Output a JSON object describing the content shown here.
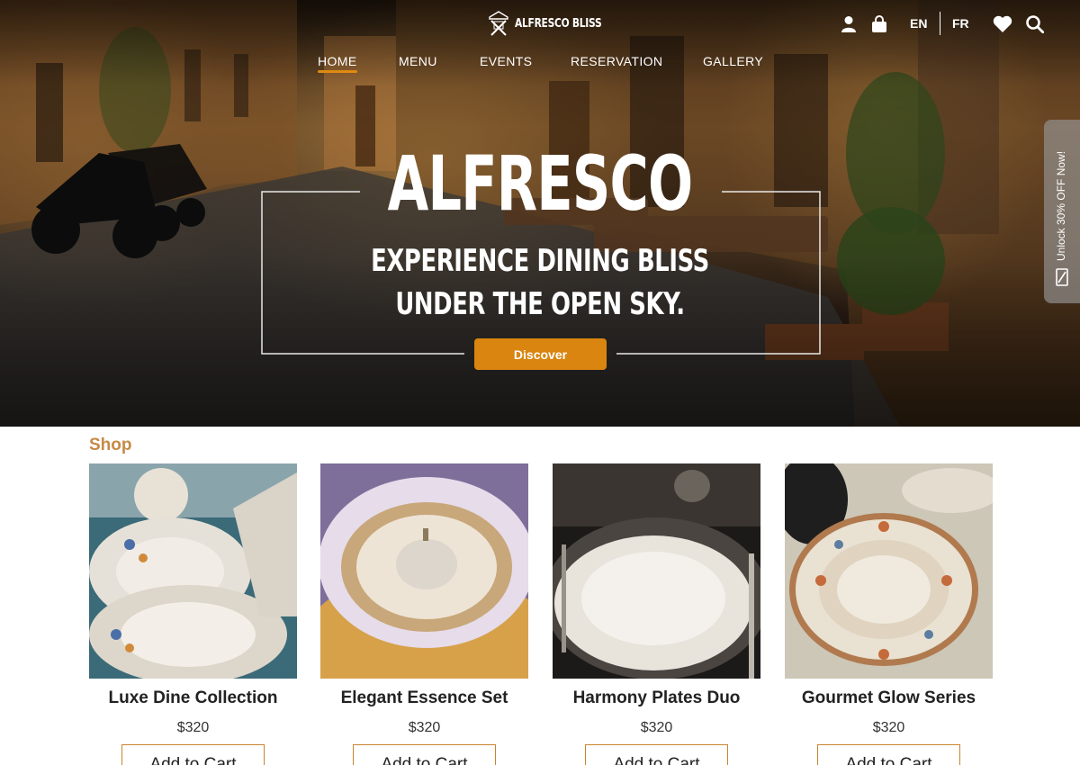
{
  "brand": {
    "name": "ALFRESCO BLISS",
    "icon": "crossed-utensils-logo-icon"
  },
  "nav": {
    "items": [
      {
        "label": "HOME",
        "active": true
      },
      {
        "label": "MENU",
        "active": false
      },
      {
        "label": "EVENTS",
        "active": false
      },
      {
        "label": "RESERVATION",
        "active": false
      },
      {
        "label": "GALLERY",
        "active": false
      }
    ]
  },
  "header_tools": {
    "icons": [
      "user-icon",
      "shopping-bag-icon",
      "heart-icon",
      "search-icon"
    ],
    "languages": [
      "EN",
      "FR"
    ]
  },
  "hero": {
    "title": "ALFRESCO",
    "subtitle": "EXPERIENCE DINING BLISS UNDER THE OPEN SKY.",
    "cta_label": "Discover"
  },
  "promo": {
    "label": "Unlock 30% OFF Now!",
    "icon": "coupon-icon"
  },
  "shop": {
    "title": "Shop",
    "products": [
      {
        "name": "Luxe Dine Collection",
        "price": "$320",
        "cta": "Add to Cart"
      },
      {
        "name": "Elegant Essence Set",
        "price": "$320",
        "cta": "Add to Cart"
      },
      {
        "name": "Harmony Plates Duo",
        "price": "$320",
        "cta": "Add to Cart"
      },
      {
        "name": "Gourmet Glow Series",
        "price": "$320",
        "cta": "Add to Cart"
      }
    ]
  },
  "colors": {
    "accent": "#d9850f",
    "shop_title": "#c68a46",
    "button_border": "#c9832e"
  }
}
